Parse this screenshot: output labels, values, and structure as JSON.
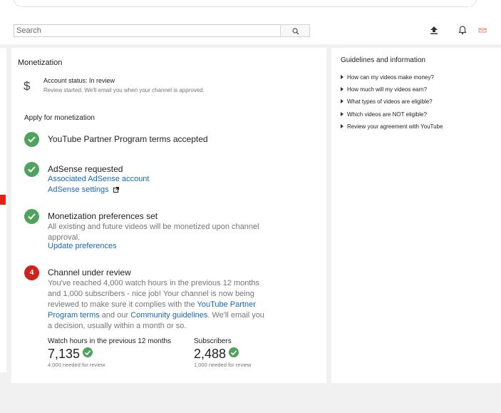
{
  "header": {
    "search": {
      "placeholder": "Search",
      "value": ""
    }
  },
  "main": {
    "title": "Monetization",
    "account": {
      "status": "Account status: In review",
      "subtitle": "Review started. We'll email you when your channel is approved."
    },
    "apply_title": "Apply for monetization",
    "steps": [
      {
        "status": "done",
        "title": "YouTube Partner Program terms accepted"
      },
      {
        "status": "done",
        "title": "AdSense requested",
        "links": [
          "Associated AdSense account",
          "AdSense settings"
        ]
      },
      {
        "status": "done",
        "title": "Monetization preferences set",
        "text": "All existing and future videos will be monetized upon channel approval.",
        "link": "Update preferences"
      },
      {
        "status": "in_review",
        "number": "4",
        "title": "Channel under review",
        "text_part1": "You've reached 4,000 watch hours in the previous 12 months and 1,000 subscribers - nice job! Your channel is now being reviewed to make sure it complies with the ",
        "link1": "YouTube Partner Program terms",
        "text_part2": " and our ",
        "link2": "Community guidelines",
        "text_part3": ". We'll email you a decision, usually within a month or so."
      }
    ],
    "metrics": [
      {
        "label": "Watch hours in the previous 12 months",
        "value": "7,135",
        "note": "4,000 needed for review"
      },
      {
        "label": "Subscribers",
        "value": "2,488",
        "note": "1,000 needed for review"
      }
    ]
  },
  "sidebar": {
    "title": "Guidelines and information",
    "items": [
      "How can my videos make money?",
      "How much will my videos earn?",
      "What types of videos are eligible?",
      "Which videos are NOT eligible?",
      "Review your agreement with YouTube"
    ]
  },
  "colors": {
    "success": "#4fa35d",
    "alert": "#d0211b",
    "link": "#1668b8",
    "accent": "#e62117"
  },
  "icons": [
    "search-icon",
    "upload-icon",
    "bell-icon",
    "inbox-icon",
    "dollar-icon",
    "check-icon",
    "external-link-icon",
    "triangle-right-icon"
  ]
}
